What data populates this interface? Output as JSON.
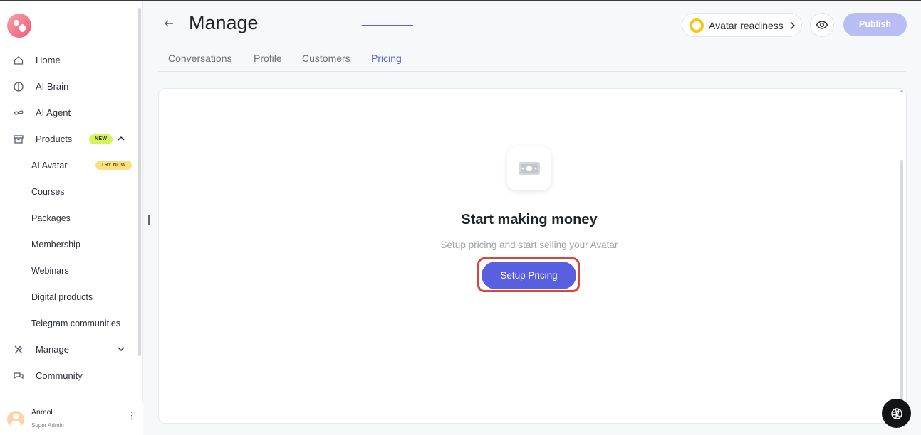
{
  "sidebar": {
    "items": [
      {
        "label": "Home",
        "icon": "home-icon"
      },
      {
        "label": "AI Brain",
        "icon": "brain-icon"
      },
      {
        "label": "AI Agent",
        "icon": "infinity-icon"
      },
      {
        "label": "Products",
        "icon": "box-icon",
        "badge": "NEW"
      }
    ],
    "sub_items": [
      "AI Avatar",
      "Courses",
      "Packages",
      "Membership",
      "Webinars",
      "Digital products",
      "Telegram communities"
    ],
    "sub_badge": "TRY NOW",
    "items_after": [
      {
        "label": "Manage",
        "icon": "tools-icon"
      },
      {
        "label": "Community",
        "icon": "chat-icon"
      }
    ],
    "user": {
      "name": "Anmol",
      "role": "Super Admin"
    }
  },
  "header": {
    "title": "Manage",
    "readiness_label": "Avatar readiness",
    "publish_label": "Publish"
  },
  "tabs": [
    {
      "label": "Conversations",
      "active": false
    },
    {
      "label": "Profile",
      "active": false
    },
    {
      "label": "Customers",
      "active": false
    },
    {
      "label": "Pricing",
      "active": true
    }
  ],
  "empty_state": {
    "icon": "money-icon",
    "heading": "Start making money",
    "subtext": "Setup pricing and start selling your Avatar",
    "cta_label": "Setup Pricing"
  },
  "colors": {
    "accent": "#5a5fe0",
    "publish_disabled": "#b8bdf3",
    "new_badge": "#d6f45a",
    "try_badge": "#fbe07d",
    "readiness_ring": "#f6c714",
    "highlight": "#d9453b"
  }
}
